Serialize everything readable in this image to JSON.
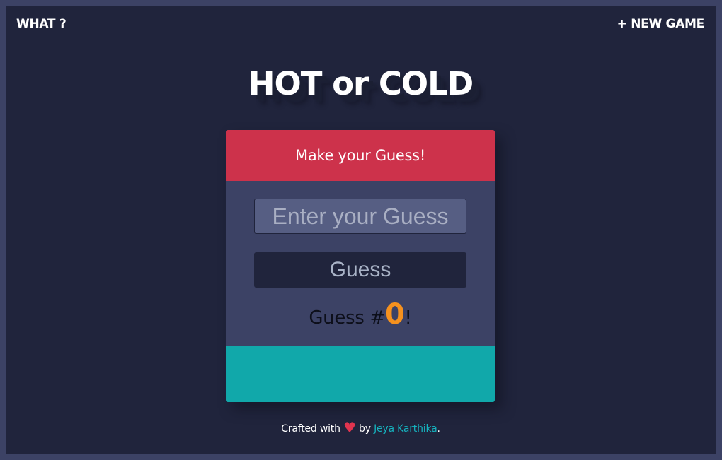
{
  "nav": {
    "what_label": "WHAT ?",
    "new_game_label": "+ NEW GAME"
  },
  "title": "HOT or COLD",
  "card": {
    "header": "Make your Guess!",
    "input_placeholder": "Enter your Guess",
    "input_value": "",
    "button_label": "Guess",
    "counter_prefix": "Guess #",
    "counter_value": "0",
    "counter_suffix": "!",
    "feedback_text": ""
  },
  "footer": {
    "prefix": "Crafted with",
    "heart": "♥",
    "by": "by",
    "author": "Jeya Karthika",
    "suffix": "."
  },
  "colors": {
    "background": "#20243c",
    "border": "#3c4265",
    "header": "#cd324b",
    "feedback": "#11a8aa",
    "counter_accent": "#f5911e",
    "link": "#15b3bf"
  }
}
